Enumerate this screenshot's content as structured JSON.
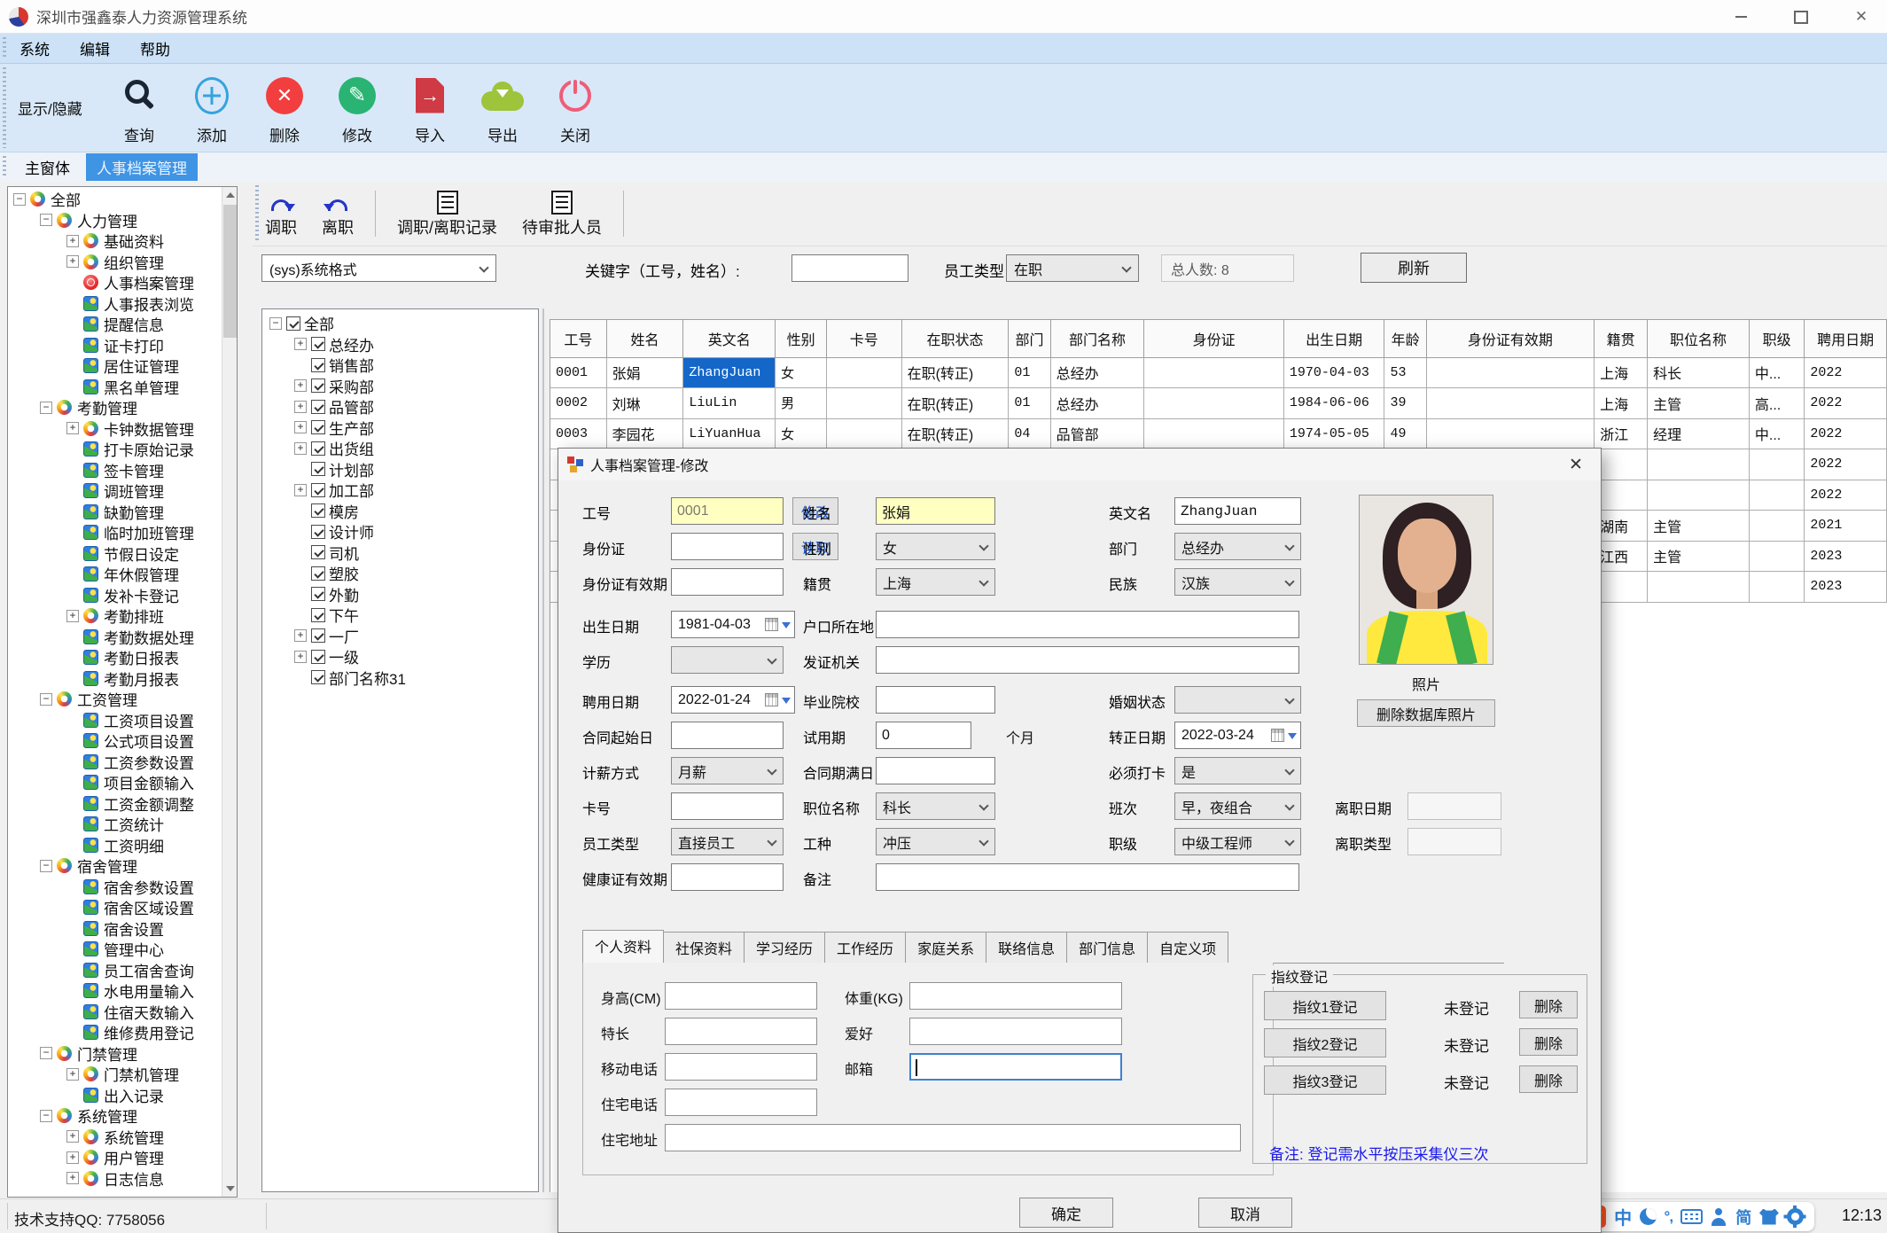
{
  "theme": {
    "accent_blue": "#3f94e4",
    "selection_blue": "#1467c8",
    "field_yellow": "#ffffc2",
    "note_blue": "#1a1aee",
    "ime_orange": "#ff5122"
  },
  "window": {
    "title": "深圳市强鑫泰人力资源管理系统"
  },
  "menu": {
    "items": [
      "系统",
      "编辑",
      "帮助"
    ]
  },
  "toolbar": {
    "toggle_label": "显示/隐藏",
    "buttons": [
      {
        "label": "查询",
        "icon": "search-icon"
      },
      {
        "label": "添加",
        "icon": "add-icon"
      },
      {
        "label": "删除",
        "icon": "delete-icon"
      },
      {
        "label": "修改",
        "icon": "edit-icon"
      },
      {
        "label": "导入",
        "icon": "import-icon"
      },
      {
        "label": "导出",
        "icon": "export-icon"
      },
      {
        "label": "关闭",
        "icon": "power-icon"
      }
    ]
  },
  "tabs": [
    {
      "label": "主窗体",
      "active": false
    },
    {
      "label": "人事档案管理",
      "active": true
    }
  ],
  "nav_tree": {
    "items": [
      {
        "label": "全部",
        "depth": 0,
        "expand": "minus",
        "icon": "branch"
      },
      {
        "label": "人力管理",
        "depth": 1,
        "expand": "minus",
        "icon": "branch"
      },
      {
        "label": "基础资料",
        "depth": 2,
        "expand": "plus",
        "icon": "branch"
      },
      {
        "label": "组织管理",
        "depth": 2,
        "expand": "plus",
        "icon": "branch"
      },
      {
        "label": "人事档案管理",
        "depth": 2,
        "expand": "none",
        "icon": "active"
      },
      {
        "label": "人事报表浏览",
        "depth": 2,
        "expand": "none",
        "icon": "leaf"
      },
      {
        "label": "提醒信息",
        "depth": 2,
        "expand": "none",
        "icon": "leaf"
      },
      {
        "label": "证卡打印",
        "depth": 2,
        "expand": "none",
        "icon": "leaf"
      },
      {
        "label": "居住证管理",
        "depth": 2,
        "expand": "none",
        "icon": "leaf"
      },
      {
        "label": "黑名单管理",
        "depth": 2,
        "expand": "none",
        "icon": "leaf"
      },
      {
        "label": "考勤管理",
        "depth": 1,
        "expand": "minus",
        "icon": "branch"
      },
      {
        "label": "卡钟数据管理",
        "depth": 2,
        "expand": "plus",
        "icon": "branch"
      },
      {
        "label": "打卡原始记录",
        "depth": 2,
        "expand": "none",
        "icon": "leaf"
      },
      {
        "label": "签卡管理",
        "depth": 2,
        "expand": "none",
        "icon": "leaf"
      },
      {
        "label": "调班管理",
        "depth": 2,
        "expand": "none",
        "icon": "leaf"
      },
      {
        "label": "缺勤管理",
        "depth": 2,
        "expand": "none",
        "icon": "leaf"
      },
      {
        "label": "临时加班管理",
        "depth": 2,
        "expand": "none",
        "icon": "leaf"
      },
      {
        "label": "节假日设定",
        "depth": 2,
        "expand": "none",
        "icon": "leaf"
      },
      {
        "label": "年休假管理",
        "depth": 2,
        "expand": "none",
        "icon": "leaf"
      },
      {
        "label": "发补卡登记",
        "depth": 2,
        "expand": "none",
        "icon": "leaf"
      },
      {
        "label": "考勤排班",
        "depth": 2,
        "expand": "plus",
        "icon": "branch"
      },
      {
        "label": "考勤数据处理",
        "depth": 2,
        "expand": "none",
        "icon": "leaf"
      },
      {
        "label": "考勤日报表",
        "depth": 2,
        "expand": "none",
        "icon": "leaf"
      },
      {
        "label": "考勤月报表",
        "depth": 2,
        "expand": "none",
        "icon": "leaf"
      },
      {
        "label": "工资管理",
        "depth": 1,
        "expand": "minus",
        "icon": "branch"
      },
      {
        "label": "工资项目设置",
        "depth": 2,
        "expand": "none",
        "icon": "leaf"
      },
      {
        "label": "公式项目设置",
        "depth": 2,
        "expand": "none",
        "icon": "leaf"
      },
      {
        "label": "工资参数设置",
        "depth": 2,
        "expand": "none",
        "icon": "leaf"
      },
      {
        "label": "项目金额输入",
        "depth": 2,
        "expand": "none",
        "icon": "leaf"
      },
      {
        "label": "工资金额调整",
        "depth": 2,
        "expand": "none",
        "icon": "leaf"
      },
      {
        "label": "工资统计",
        "depth": 2,
        "expand": "none",
        "icon": "leaf"
      },
      {
        "label": "工资明细",
        "depth": 2,
        "expand": "none",
        "icon": "leaf"
      },
      {
        "label": "宿舍管理",
        "depth": 1,
        "expand": "minus",
        "icon": "branch"
      },
      {
        "label": "宿舍参数设置",
        "depth": 2,
        "expand": "none",
        "icon": "leaf"
      },
      {
        "label": "宿舍区域设置",
        "depth": 2,
        "expand": "none",
        "icon": "leaf"
      },
      {
        "label": "宿舍设置",
        "depth": 2,
        "expand": "none",
        "icon": "leaf"
      },
      {
        "label": "管理中心",
        "depth": 2,
        "expand": "none",
        "icon": "leaf"
      },
      {
        "label": "员工宿舍查询",
        "depth": 2,
        "expand": "none",
        "icon": "leaf"
      },
      {
        "label": "水电用量输入",
        "depth": 2,
        "expand": "none",
        "icon": "leaf"
      },
      {
        "label": "住宿天数输入",
        "depth": 2,
        "expand": "none",
        "icon": "leaf"
      },
      {
        "label": "维修费用登记",
        "depth": 2,
        "expand": "none",
        "icon": "leaf"
      },
      {
        "label": "门禁管理",
        "depth": 1,
        "expand": "minus",
        "icon": "branch"
      },
      {
        "label": "门禁机管理",
        "depth": 2,
        "expand": "plus",
        "icon": "branch"
      },
      {
        "label": "出入记录",
        "depth": 2,
        "expand": "none",
        "icon": "leaf"
      },
      {
        "label": "系统管理",
        "depth": 1,
        "expand": "minus",
        "icon": "branch"
      },
      {
        "label": "系统管理",
        "depth": 2,
        "expand": "plus",
        "icon": "branch"
      },
      {
        "label": "用户管理",
        "depth": 2,
        "expand": "plus",
        "icon": "branch"
      },
      {
        "label": "日志信息",
        "depth": 2,
        "expand": "plus",
        "icon": "branch"
      }
    ]
  },
  "main": {
    "actions": [
      {
        "label": "调职",
        "icon": "redo-arrow-icon"
      },
      {
        "label": "离职",
        "icon": "undo-arrow-icon"
      },
      {
        "label": "调职/离职记录",
        "icon": "document-icon"
      },
      {
        "label": "待审批人员",
        "icon": "document-icon"
      }
    ],
    "filter": {
      "format_value": "(sys)系统格式",
      "keyword_label": "关键字（工号，姓名）:",
      "keyword_value": "",
      "type_label": "员工类型",
      "type_value": "在职",
      "total_text": "总人数: 8",
      "refresh_label": "刷新"
    },
    "dept_tree": {
      "items": [
        {
          "label": "全部",
          "depth": 0,
          "expand": "minus",
          "checked": true
        },
        {
          "label": "总经办",
          "depth": 1,
          "expand": "plus",
          "checked": true
        },
        {
          "label": "销售部",
          "depth": 1,
          "expand": "none",
          "checked": true
        },
        {
          "label": "采购部",
          "depth": 1,
          "expand": "plus",
          "checked": true
        },
        {
          "label": "品管部",
          "depth": 1,
          "expand": "plus",
          "checked": true
        },
        {
          "label": "生产部",
          "depth": 1,
          "expand": "plus",
          "checked": true
        },
        {
          "label": "出货组",
          "depth": 1,
          "expand": "plus",
          "checked": true
        },
        {
          "label": "计划部",
          "depth": 1,
          "expand": "none",
          "checked": true
        },
        {
          "label": "加工部",
          "depth": 1,
          "expand": "plus",
          "checked": true
        },
        {
          "label": "模房",
          "depth": 1,
          "expand": "none",
          "checked": true
        },
        {
          "label": "设计师",
          "depth": 1,
          "expand": "none",
          "checked": true
        },
        {
          "label": "司机",
          "depth": 1,
          "expand": "none",
          "checked": true
        },
        {
          "label": "塑胶",
          "depth": 1,
          "expand": "none",
          "checked": true
        },
        {
          "label": "外勤",
          "depth": 1,
          "expand": "none",
          "checked": true
        },
        {
          "label": "下午",
          "depth": 1,
          "expand": "none",
          "checked": true
        },
        {
          "label": "一厂",
          "depth": 1,
          "expand": "plus",
          "checked": true
        },
        {
          "label": "一级",
          "depth": 1,
          "expand": "plus",
          "checked": true
        },
        {
          "label": "部门名称31",
          "depth": 1,
          "expand": "none",
          "checked": true
        }
      ]
    },
    "table": {
      "columns": [
        "工号",
        "姓名",
        "英文名",
        "性别",
        "卡号",
        "在职状态",
        "部门",
        "部门名称",
        "身份证",
        "出生日期",
        "年龄",
        "身份证有效期",
        "籍贯",
        "职位名称",
        "职级",
        "聘用日期"
      ],
      "rows": [
        [
          "0001",
          "张娟",
          "ZhangJuan",
          "女",
          "",
          "在职(转正)",
          "01",
          "总经办",
          "",
          "1970-04-03",
          "53",
          "",
          "上海",
          "科长",
          "中...",
          "2022"
        ],
        [
          "0002",
          "刘琳",
          "LiuLin",
          "男",
          "",
          "在职(转正)",
          "01",
          "总经办",
          "",
          "1984-06-06",
          "39",
          "",
          "上海",
          "主管",
          "高...",
          "2022"
        ],
        [
          "0003",
          "李园花",
          "LiYuanHua",
          "女",
          "",
          "在职(转正)",
          "04",
          "品管部",
          "",
          "1974-05-05",
          "49",
          "",
          "浙江",
          "经理",
          "中...",
          "2022"
        ],
        [
          "",
          "",
          "",
          "",
          "",
          "",
          "",
          "",
          "",
          "",
          "",
          "",
          "",
          "",
          "",
          "2022"
        ],
        [
          "",
          "",
          "",
          "",
          "",
          "",
          "",
          "",
          "",
          "",
          "",
          "",
          "",
          "",
          "",
          "2022"
        ],
        [
          "",
          "",
          "",
          "",
          "",
          "",
          "",
          "",
          "",
          "",
          "",
          "",
          "湖南",
          "主管",
          "",
          "2021"
        ],
        [
          "",
          "",
          "",
          "",
          "",
          "",
          "",
          "",
          "",
          "",
          "",
          "",
          "江西",
          "主管",
          "",
          "2023"
        ],
        [
          "",
          "",
          "",
          "",
          "",
          "",
          "",
          "",
          "",
          "",
          "",
          "",
          "",
          "",
          "",
          "2023"
        ]
      ],
      "selected": {
        "row": 0,
        "col": 2
      }
    }
  },
  "dialog": {
    "title": "人事档案管理-修改",
    "fields": {
      "gonghao_label": "工号",
      "gonghao_value": "0001",
      "modify_btn": "修改",
      "name_label": "姓名",
      "name_value": "张娟",
      "en_name_label": "英文名",
      "en_name_value": "ZhangJuan",
      "id_label": "身份证",
      "read_btn": "读取",
      "gender_label": "性别",
      "gender_value": "女",
      "dept_label": "部门",
      "dept_value": "总经办",
      "id_valid_label": "身份证有效期",
      "native_label": "籍贯",
      "native_value": "上海",
      "ethnic_label": "民族",
      "ethnic_value": "汉族",
      "birth_label": "出生日期",
      "birth_value": "1981-04-03",
      "hukou_label": "户口所在地",
      "edu_label": "学历",
      "issuer_label": "发证机关",
      "hire_label": "聘用日期",
      "hire_value": "2022-01-24",
      "school_label": "毕业院校",
      "marriage_label": "婚姻状态",
      "contract_start_label": "合同起始日",
      "probation_label": "试用期",
      "probation_value": "0",
      "probation_unit": "个月",
      "regular_label": "转正日期",
      "regular_value": "2022-03-24",
      "salary_mode_label": "计薪方式",
      "salary_mode_value": "月薪",
      "contract_end_label": "合同期满日",
      "must_punch_label": "必须打卡",
      "must_punch_value": "是",
      "card_label": "卡号",
      "position_label": "职位名称",
      "position_value": "科长",
      "shift_label": "班次",
      "shift_value": "早，夜组合",
      "emp_type_label": "员工类型",
      "emp_type_value": "直接员工",
      "work_type_label": "工种",
      "work_type_value": "冲压",
      "rank_label": "职级",
      "rank_value": "中级工程师",
      "health_label": "健康证有效期",
      "remark_label": "备注",
      "photo_label": "照片",
      "delete_photo_btn": "删除数据库照片",
      "leave_date_label": "离职日期",
      "leave_type_label": "离职类型"
    },
    "tabs": [
      "个人资料",
      "社保资料",
      "学习经历",
      "工作经历",
      "家庭关系",
      "联络信息",
      "部门信息",
      "自定义项"
    ],
    "personal": {
      "height_label": "身高(CM)",
      "weight_label": "体重(KG)",
      "specialty_label": "特长",
      "hobby_label": "爱好",
      "mobile_label": "移动电话",
      "email_label": "邮箱",
      "home_phone_label": "住宅电话",
      "address_label": "住宅地址"
    },
    "fingerprint": {
      "legend": "指纹登记",
      "rows": [
        {
          "btn": "指纹1登记",
          "status": "未登记",
          "del": "删除"
        },
        {
          "btn": "指纹2登记",
          "status": "未登记",
          "del": "删除"
        },
        {
          "btn": "指纹3登记",
          "status": "未登记",
          "del": "删除"
        }
      ],
      "note": "备注: 登记需水平按压采集仪三次"
    },
    "buttons": {
      "ok": "确定",
      "cancel": "取消"
    }
  },
  "statusbar": {
    "support_text": "技术支持QQ: 7758056",
    "time": "12:13"
  },
  "ime": {
    "wan": "万",
    "zh": "中",
    "tone": "°,",
    "jian": "简"
  }
}
